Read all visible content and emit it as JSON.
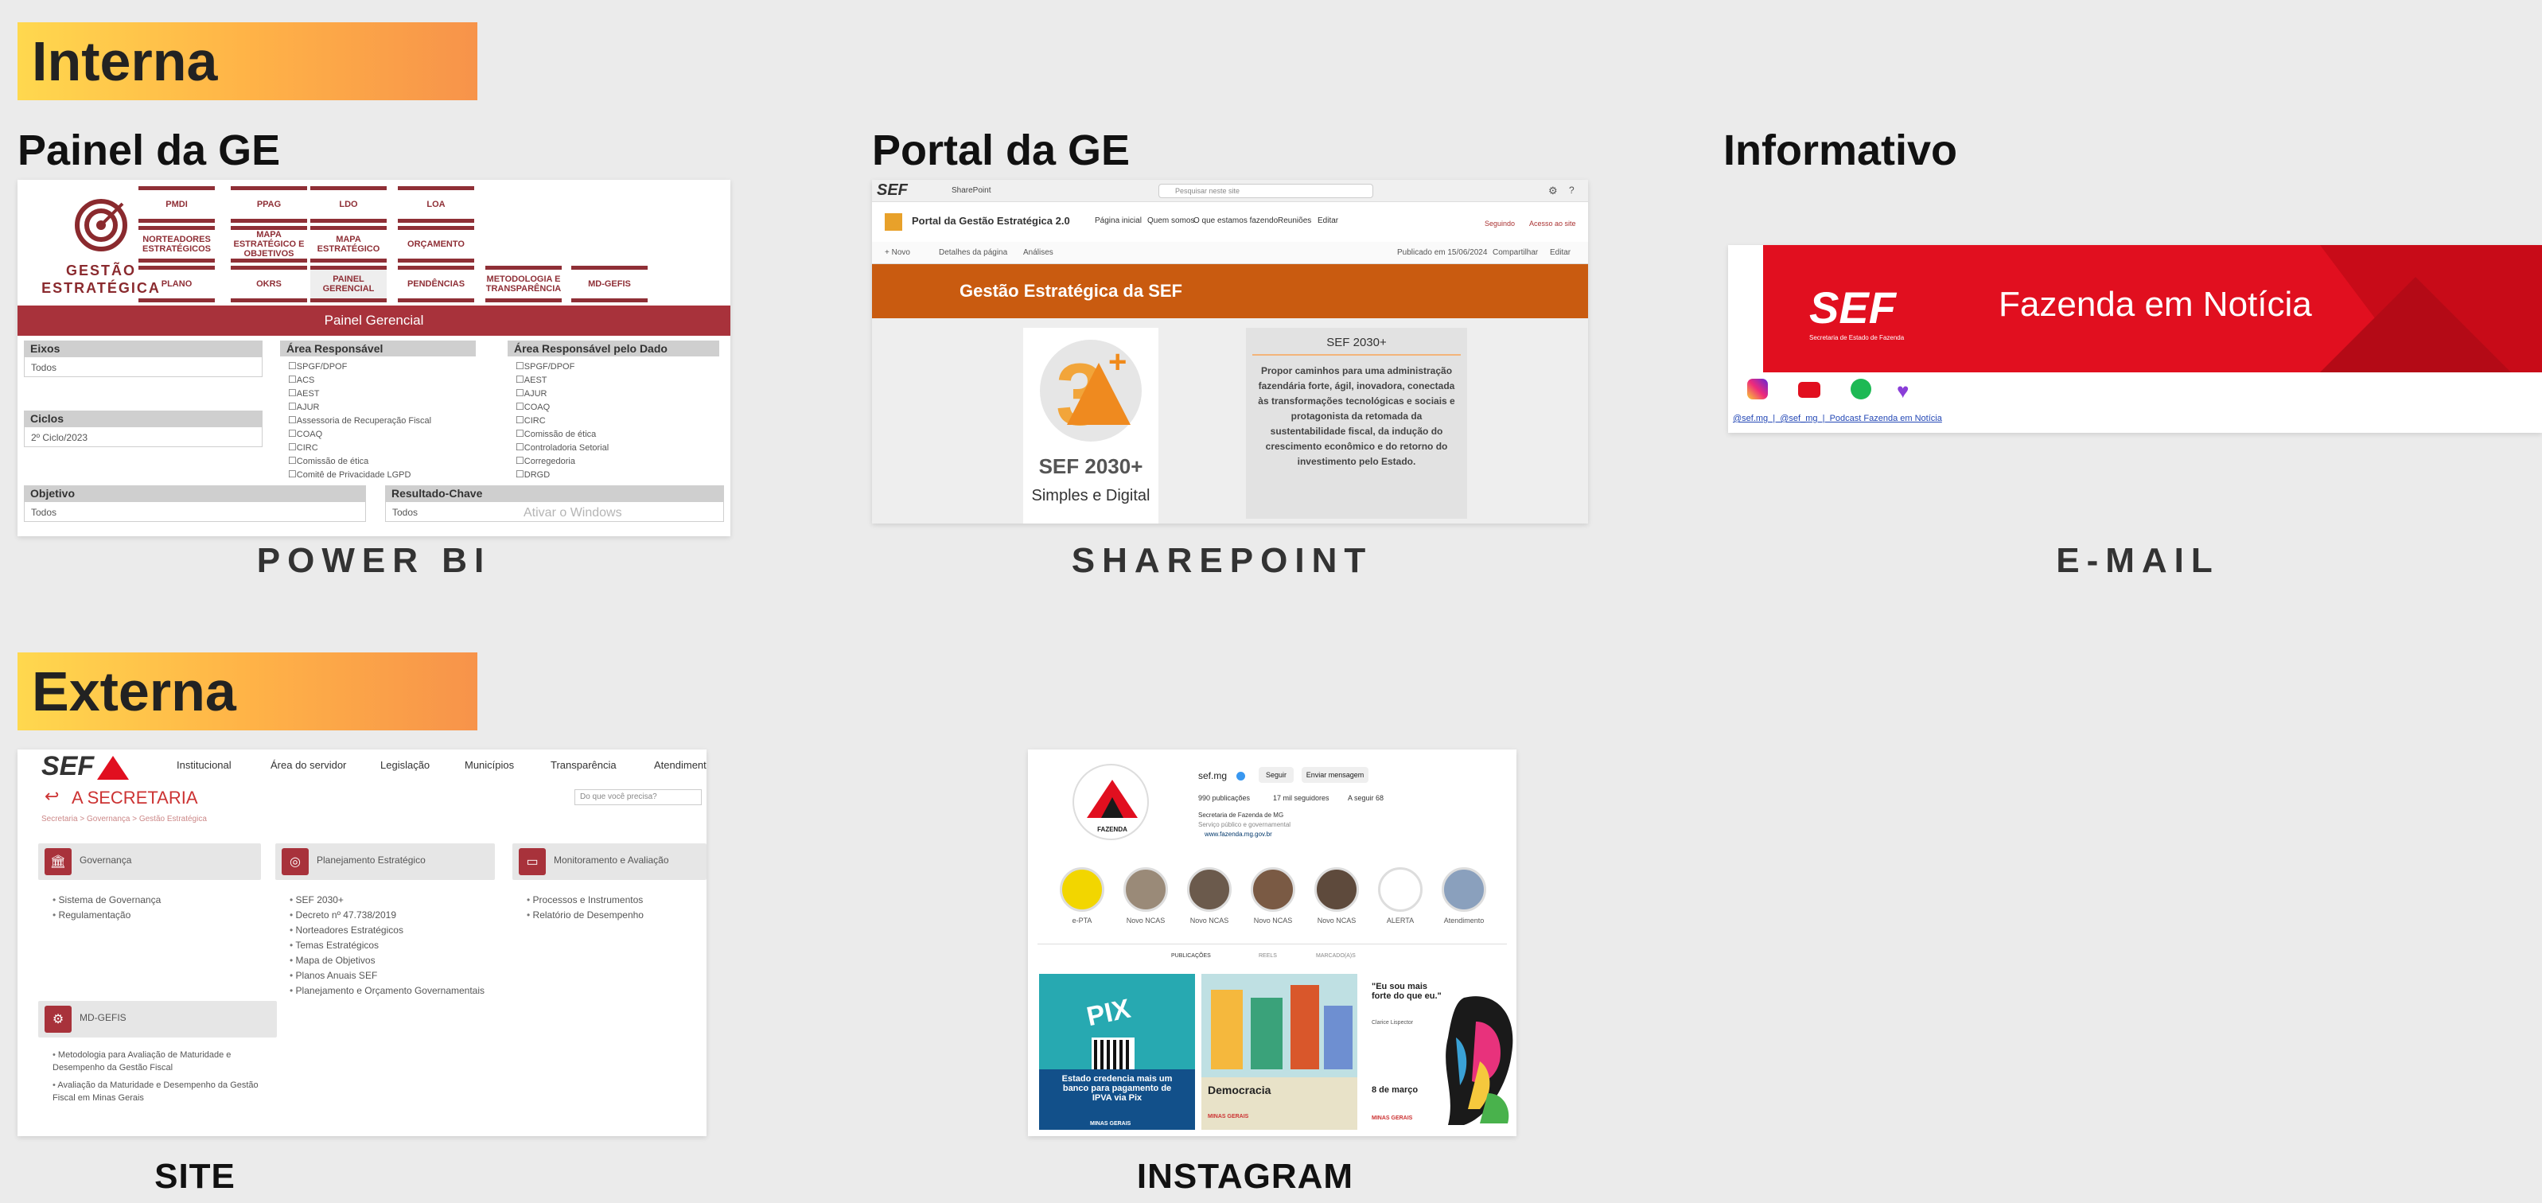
{
  "sections": {
    "interna": "Interna",
    "externa": "Externa"
  },
  "cards": {
    "painel": {
      "title": "Painel da GE",
      "caption": "POWER BI"
    },
    "portal": {
      "title": "Portal da GE",
      "caption": "SHAREPOINT"
    },
    "informativo": {
      "title": "Informativo",
      "caption": "E-MAIL"
    },
    "site": {
      "caption": "SITE"
    },
    "instagram": {
      "caption": "INSTAGRAM"
    }
  },
  "powerbi": {
    "logo_text": "GESTÃO\nESTRATÉGICA",
    "buttons": [
      "PMDI",
      "PPAG",
      "LDO",
      "LOA",
      "NORTEADORES ESTRATÉGICOS",
      "MAPA ESTRATÉGICO E OBJETIVOS",
      "MAPA ESTRATÉGICO",
      "ORÇAMENTO",
      "PLANO",
      "OKRS",
      "PAINEL GERENCIAL",
      "PENDÊNCIAS",
      "METODOLOGIA E TRANSPARÊNCIA",
      "MD-GEFIS"
    ],
    "header": "Painel Gerencial",
    "filters": {
      "eixos_label": "Eixos",
      "eixos_value": "Todos",
      "ciclos_label": "Ciclos",
      "ciclos_value": "2º Ciclo/2023",
      "area_label": "Área Responsável",
      "area_items": [
        "SPGF/DPOF",
        "ACS",
        "AEST",
        "AJUR",
        "Assessoria de Recuperação Fiscal",
        "COAQ",
        "CIRC",
        "Comissão de ética",
        "Comitê de Privacidade LGPD"
      ],
      "area_dado_label": "Área Responsável pelo Dado",
      "area_dado_items": [
        "SPGF/DPOF",
        "AEST",
        "AJUR",
        "COAQ",
        "CIRC",
        "Comissão de ética",
        "Controladoria Setorial",
        "Corregedoria",
        "DRGD"
      ],
      "objetivo_label": "Objetivo",
      "objetivo_value": "Todos",
      "resultado_label": "Resultado-Chave",
      "resultado_value": "Todos",
      "watermark": "Ativar o Windows"
    }
  },
  "sharepoint": {
    "search_placeholder": "Pesquisar neste site",
    "app_name": "SharePoint",
    "site_title": "Portal da Gestão Estratégica 2.0",
    "nav": [
      "Página inicial",
      "Quem somos",
      "O que estamos fazendo",
      "Reuniões",
      "Editar"
    ],
    "follow": "Seguindo",
    "access": "Acesso ao site",
    "cmd_new": "+ Novo",
    "cmd_details": "Detalhes da página",
    "cmd_analytics": "Análises",
    "cmd_published": "Publicado em 15/06/2024",
    "cmd_share": "Compartilhar",
    "cmd_edit": "Editar",
    "banner": "Gestão Estratégica da SEF",
    "sef2030_caption": "SEF 2030+",
    "simples": "Simples e Digital",
    "box_title": "SEF 2030+",
    "box_text": "Propor caminhos para uma administração fazendária forte, ágil, inovadora, conectada às transformações tecnológicas e sociais e protagonista da retomada da sustentabilidade fiscal, da indução do crescimento econômico e do retorno do investimento pelo Estado."
  },
  "email": {
    "logo": "SEF",
    "logo_sub": "Secretaria de Estado de Fazenda",
    "headline": "Fazenda em Notícia",
    "links": "@sef.mg  |  @sef_mg  |  Podcast Fazenda em Notícia"
  },
  "site": {
    "logo": "SEF",
    "menu": [
      "Institucional",
      "Área do servidor",
      "Legislação",
      "Municípios",
      "Transparência",
      "Atendimento"
    ],
    "search_placeholder": "Do que você precisa?",
    "heading": "A SECRETARIA",
    "breadcrumb": "Secretaria > Governança > Gestão Estratégica",
    "boxes": [
      {
        "label": "Governança",
        "items": [
          "Sistema de Governança",
          "Regulamentação"
        ]
      },
      {
        "label": "Planejamento Estratégico",
        "items": [
          "SEF 2030+",
          "Decreto nº 47.738/2019",
          "Norteadores Estratégicos",
          "Temas Estratégicos",
          "Mapa de Objetivos",
          "Planos Anuais SEF",
          "Planejamento e Orçamento Governamentais"
        ]
      },
      {
        "label": "Monitoramento e Avaliação",
        "items": [
          "Processos e Instrumentos",
          "Relatório de Desempenho"
        ]
      },
      {
        "label": "MD-GEFIS",
        "items": [
          "Metodologia para Avaliação de Maturidade e Desempenho da Gestão Fiscal",
          "Avaliação da Maturidade e Desempenho da Gestão Fiscal em Minas Gerais"
        ]
      }
    ]
  },
  "instagram": {
    "handle": "sef.mg",
    "follow_btn": "Seguir",
    "message_btn": "Enviar mensagem",
    "stats": [
      "990 publicações",
      "17 mil seguidores",
      "A seguir 68"
    ],
    "bio_name": "Secretaria de Fazenda de MG",
    "bio_line": "Serviço público e governamental",
    "bio_link": "www.fazenda.mg.gov.br",
    "profile_label": "FAZENDA",
    "stories": [
      "e-PTA",
      "Novo NCAS",
      "Novo NCAS",
      "Novo NCAS",
      "Novo NCAS",
      "ALERTA",
      "Atendimento"
    ],
    "tabs": [
      "PUBLICAÇÕES",
      "REELS",
      "MARCADO(A)S"
    ],
    "post1_title": "PIX",
    "post1_caption": "Estado credencia mais um banco para pagamento de IPVA via Pix",
    "post2_caption": "Democracia",
    "post3_quote": "\"Eu sou mais forte do que eu.\"",
    "post3_author": "Clarice Lispector",
    "post3_date": "8 de março",
    "minas": "MINAS GERAIS"
  },
  "colors": {
    "banner_start": "#ffd84e",
    "banner_end": "#f7934a",
    "sef_red": "#e10f1f",
    "pbi_red": "#a8323b",
    "sp_orange": "#c95b10"
  }
}
